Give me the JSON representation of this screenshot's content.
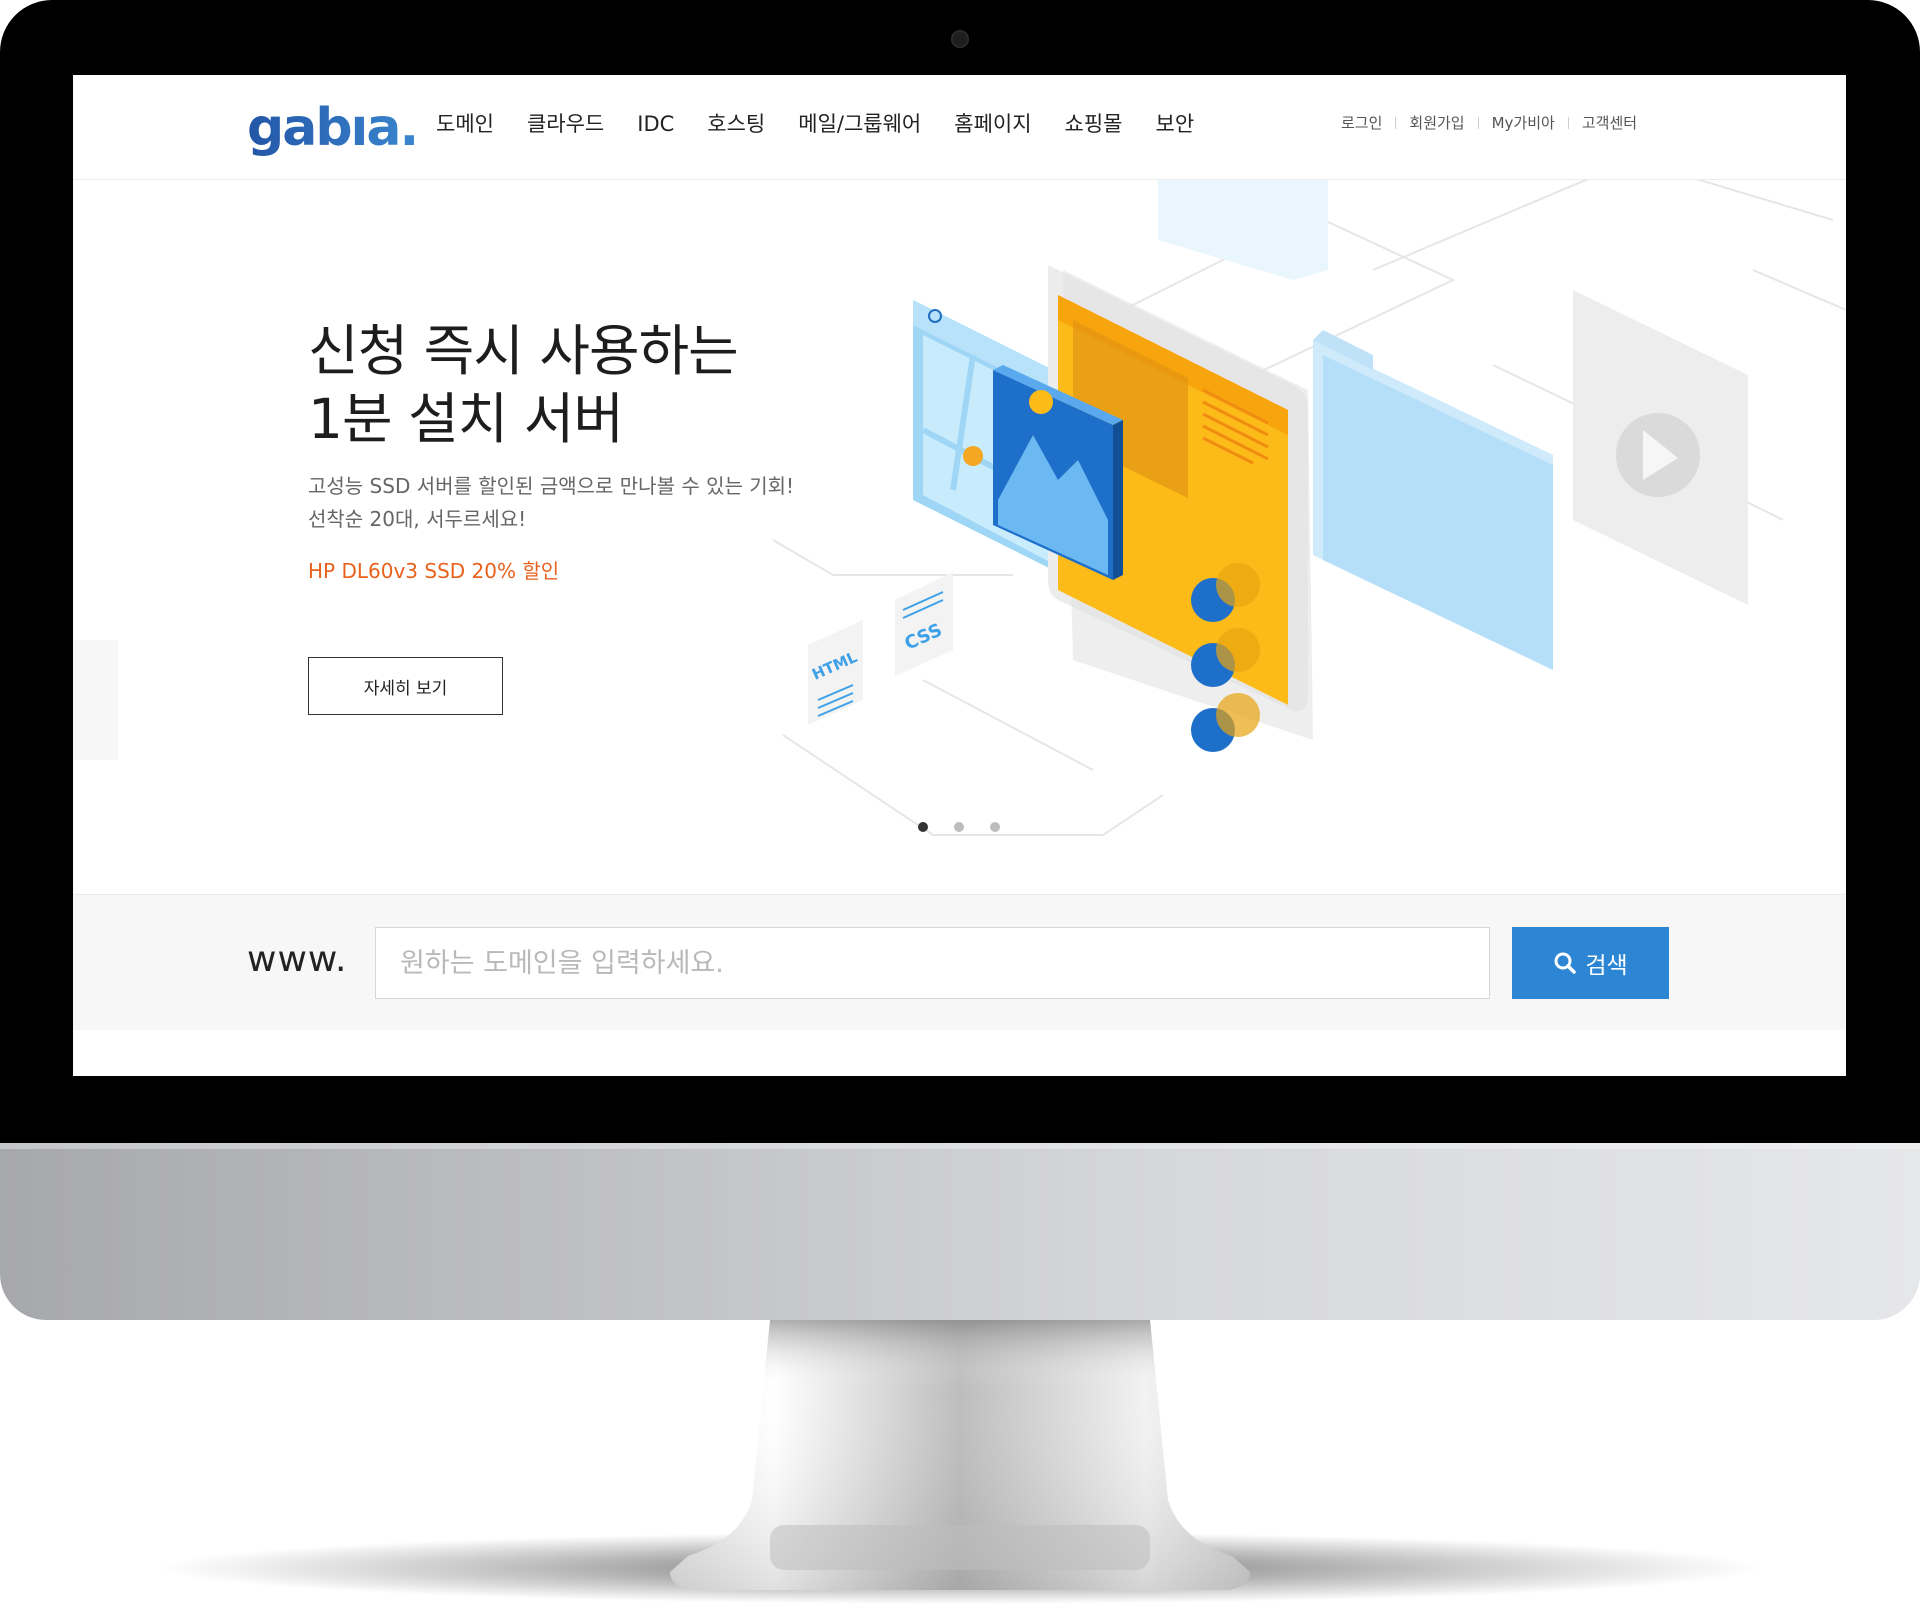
{
  "header": {
    "logo_text": "gabıa.",
    "nav": [
      "도메인",
      "클라우드",
      "IDC",
      "호스팅",
      "메일/그룹웨어",
      "홈페이지",
      "쇼핑몰",
      "보안"
    ],
    "util": [
      "로그인",
      "회원가입",
      "My가비아",
      "고객센터"
    ]
  },
  "hero": {
    "title_line1": "신청 즉시 사용하는",
    "title_line2": "1분 설치 서버",
    "desc_line1": "고성능 SSD 서버를 할인된 금액으로 만나볼 수 있는 기회!",
    "desc_line2": "선착순 20대, 서두르세요!",
    "promo": "HP DL60v3 SSD 20% 할인",
    "button_label": "자세히 보기",
    "illustration_labels": {
      "html": "HTML",
      "css": "CSS"
    },
    "carousel": {
      "total": 3,
      "active": 1
    }
  },
  "domain_search": {
    "prefix": "www.",
    "placeholder": "원하는 도메인을 입력하세요.",
    "button_label": "검색",
    "button_icon": "search-icon"
  },
  "colors": {
    "accent_blue": "#2d86d4",
    "promo_orange": "#e8611d",
    "illustration_yellow": "#fcb614",
    "bezel": "#000000"
  }
}
